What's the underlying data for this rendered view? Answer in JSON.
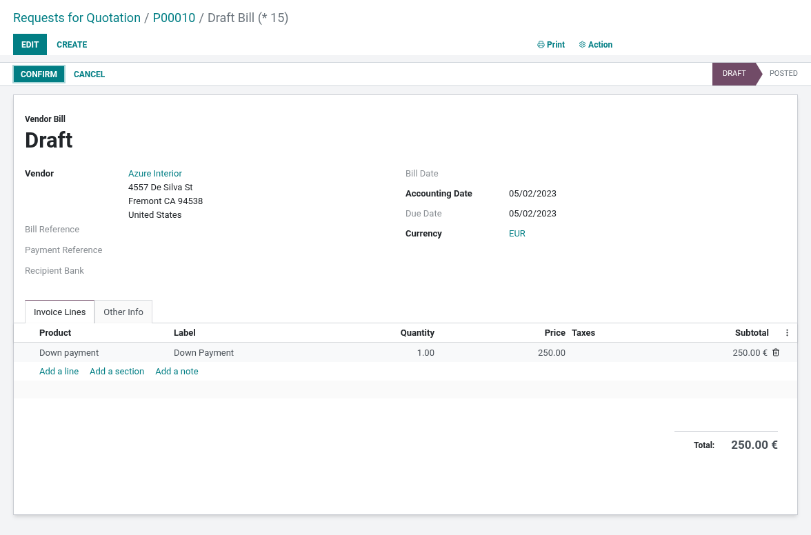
{
  "breadcrumbs": [
    {
      "label": "Requests for Quotation",
      "link": true
    },
    {
      "separator": "/",
      "label": "P00010",
      "link": true
    },
    {
      "separator": "/",
      "label": "Draft Bill (* 15)",
      "link": false
    }
  ],
  "control_buttons": [
    {
      "label": "EDIT",
      "primary": true
    },
    {
      "label": "CREATE",
      "primary": false
    }
  ],
  "actions": [
    {
      "label": "Print",
      "kind": "print"
    },
    {
      "label": "Action",
      "kind": "gear"
    }
  ],
  "status_buttons": [
    {
      "label": "CONFIRM",
      "primary": true
    },
    {
      "label": "CANCEL",
      "primary": false
    }
  ],
  "stages": [
    {
      "label": "DRAFT",
      "selected": true
    },
    {
      "label": "POSTED",
      "selected": false
    }
  ],
  "document": {
    "type": "Vendor Bill",
    "name": "Draft"
  },
  "left_fields": [
    {
      "label": "Vendor",
      "required": true,
      "value": "Azure Interior",
      "link": true,
      "address": [
        "4557 De Silva St",
        "Fremont CA 94538",
        "United States"
      ]
    },
    {
      "label": "Bill Reference",
      "required": false
    },
    {
      "label": "Payment Reference",
      "required": false
    },
    {
      "label": "Recipient Bank",
      "required": false
    }
  ],
  "right_fields": [
    {
      "label": "Bill Date",
      "required": false
    },
    {
      "label": "Accounting Date",
      "required": true,
      "value": "05/02/2023",
      "link": false
    },
    {
      "label": "Due Date",
      "required": false,
      "value": "05/02/2023",
      "link": false
    },
    {
      "label": "Currency",
      "required": true,
      "value": "EUR",
      "link": true
    }
  ],
  "tabs": [
    {
      "label": "Invoice Lines",
      "selected": true
    },
    {
      "label": "Other Info",
      "selected": false
    }
  ],
  "table": {
    "columns": [
      "Product",
      "Label",
      "Quantity",
      "Price",
      "Taxes",
      "Subtotal"
    ],
    "rows": [
      [
        "Down payment",
        "Down Payment",
        "1.00",
        "250.00",
        "",
        "250.00 €"
      ]
    ],
    "add_links": [
      "Add a line",
      "Add a section",
      "Add a note"
    ]
  },
  "total": {
    "label": "Total:",
    "value": "250.00 €"
  }
}
